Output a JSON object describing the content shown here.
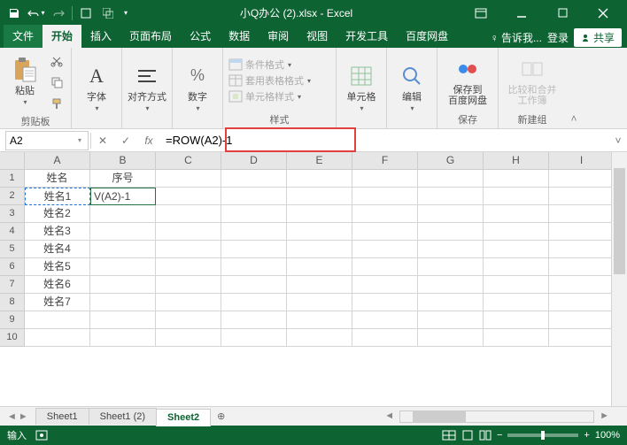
{
  "titlebar": {
    "filename": "小Q办公 (2).xlsx - Excel"
  },
  "tabs": {
    "file": "文件",
    "home": "开始",
    "insert": "插入",
    "layout": "页面布局",
    "formulas": "公式",
    "data": "数据",
    "review": "审阅",
    "view": "视图",
    "dev": "开发工具",
    "baidu": "百度网盘",
    "tellme": "告诉我...",
    "login": "登录",
    "share": "共享"
  },
  "ribbon": {
    "paste": "粘贴",
    "clipboard": "剪贴板",
    "font": "字体",
    "align": "对齐方式",
    "number": "数字",
    "condfmt": "条件格式",
    "tablefmt": "套用表格格式",
    "cellstyle": "单元格样式",
    "styles": "样式",
    "cells": "单元格",
    "editing": "编辑",
    "save_baidu_top": "保存到",
    "save_baidu_bottom": "百度网盘",
    "save_group": "保存",
    "compare_top": "比较和合并",
    "compare_bottom": "工作簿",
    "newgroup": "新建组"
  },
  "formula_bar": {
    "namebox": "A2",
    "formula": "=ROW(A2)-1"
  },
  "sheet": {
    "cols": [
      "A",
      "B",
      "C",
      "D",
      "E",
      "F",
      "G",
      "H",
      "I"
    ],
    "rows": [
      "1",
      "2",
      "3",
      "4",
      "5",
      "6",
      "7",
      "8",
      "9",
      "10"
    ],
    "data": {
      "A1": "姓名",
      "B1": "序号",
      "A2": "姓名1",
      "B2": "V(A2)-1",
      "A3": "姓名2",
      "A4": "姓名3",
      "A5": "姓名4",
      "A6": "姓名5",
      "A7": "姓名6",
      "A8": "姓名7"
    }
  },
  "sheet_tabs": {
    "s1": "Sheet1",
    "s2": "Sheet1 (2)",
    "s3": "Sheet2"
  },
  "statusbar": {
    "mode": "输入",
    "zoom": "100%"
  }
}
